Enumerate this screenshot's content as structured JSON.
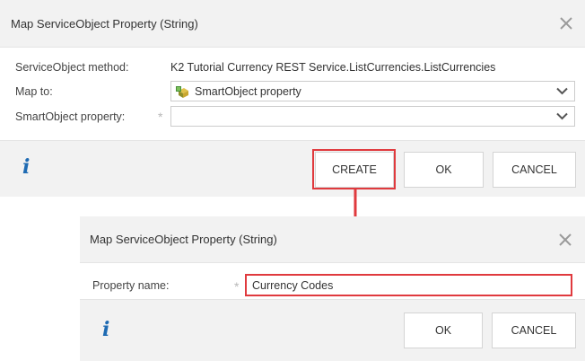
{
  "dialog1": {
    "title": "Map ServiceObject Property (String)",
    "method_label": "ServiceObject method:",
    "method_value": "K2 Tutorial Currency REST Service.ListCurrencies.ListCurrencies",
    "map_to_label": "Map to:",
    "map_to_value": "SmartObject property",
    "smartobject_property_label": "SmartObject property:",
    "smartobject_property_value": "",
    "required_mark": "*",
    "info_glyph": "i",
    "buttons": {
      "create": "CREATE",
      "ok": "OK",
      "cancel": "CANCEL"
    }
  },
  "dialog2": {
    "title": "Map ServiceObject Property (String)",
    "property_name_label": "Property name:",
    "property_name_value": "Currency Codes",
    "required_mark": "*",
    "info_glyph": "i",
    "buttons": {
      "ok": "OK",
      "cancel": "CANCEL"
    }
  },
  "icons": {
    "close": "close-icon",
    "dropdown": "chevron-down-icon",
    "smartobject": "smartobject-cube-icon",
    "info": "info-icon",
    "callout_arrow": "arrow-down-icon"
  },
  "colors": {
    "highlight": "#e03a3e",
    "info": "#1f6bb3",
    "header_bg": "#f2f2f2"
  }
}
